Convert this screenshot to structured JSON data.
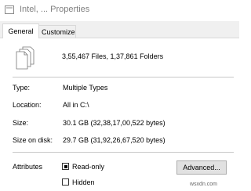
{
  "window": {
    "title": "Intel, ... Properties"
  },
  "tabs": [
    {
      "label": "General",
      "active": true
    },
    {
      "label": "Customize",
      "active": false
    }
  ],
  "summary": {
    "text": "3,55,467 Files, 1,37,861 Folders"
  },
  "properties": [
    {
      "label": "Type:",
      "value": "Multiple Types"
    },
    {
      "label": "Location:",
      "value": "All in C:\\"
    },
    {
      "label": "Size:",
      "value": "30.1 GB (32,38,17,00,522 bytes)"
    },
    {
      "label": "Size on disk:",
      "value": "29.7 GB (31,92,26,67,520 bytes)"
    }
  ],
  "attributes": {
    "label": "Attributes",
    "read_only": {
      "label": "Read-only",
      "state": "indeterminate"
    },
    "hidden": {
      "label": "Hidden",
      "state": "unchecked"
    },
    "advanced_button": "Advanced..."
  },
  "watermark": "wsxdn.com",
  "icons": {
    "title": "folder-icon",
    "files": "multiple-files-icon"
  }
}
